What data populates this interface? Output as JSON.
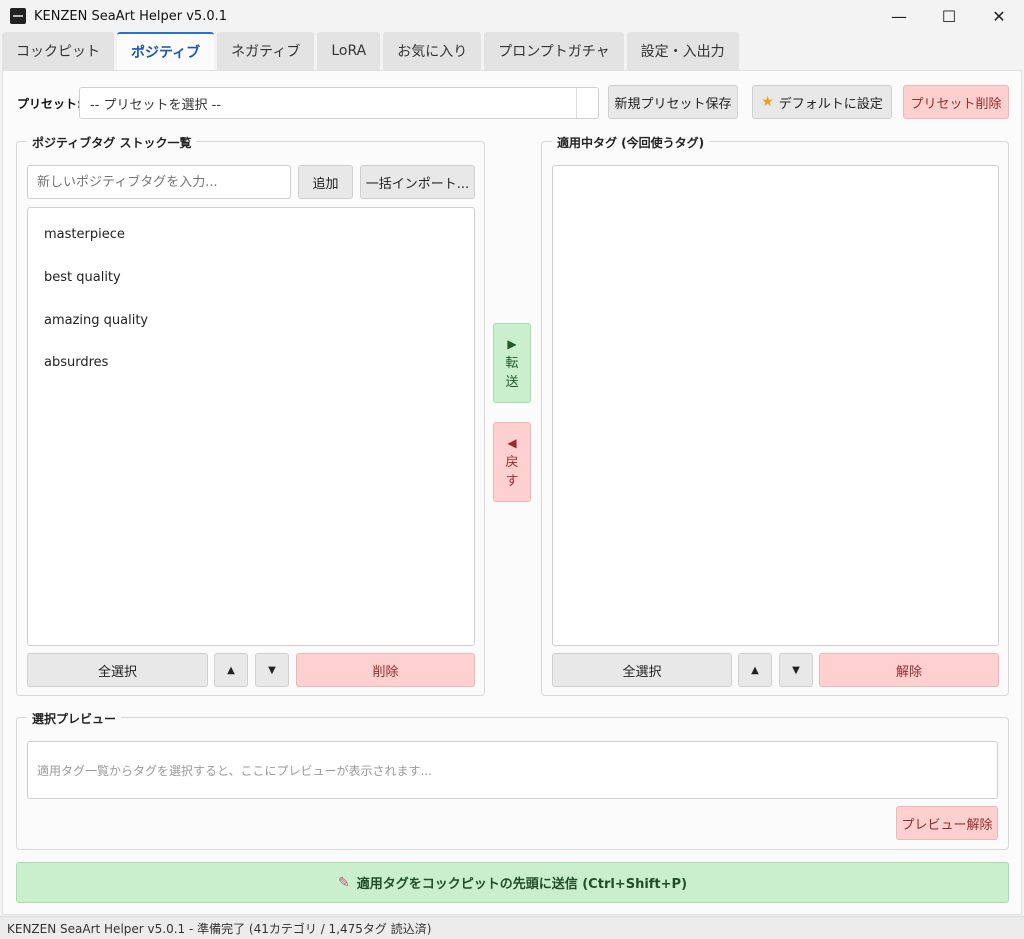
{
  "window": {
    "title": "KENZEN SeaArt Helper v5.0.1",
    "minimize": "—",
    "maximize": "☐",
    "close": "✕"
  },
  "tabs": [
    {
      "label": "コックピット",
      "active": false
    },
    {
      "label": "ポジティブ",
      "active": true
    },
    {
      "label": "ネガティブ",
      "active": false
    },
    {
      "label": "LoRA",
      "active": false
    },
    {
      "label": "お気に入り",
      "active": false
    },
    {
      "label": "プロンプトガチャ",
      "active": false
    },
    {
      "label": "設定・入出力",
      "active": false
    }
  ],
  "preset": {
    "label": "プリセット:",
    "selected": "-- プリセットを選択 --",
    "save_button": "新規プリセット保存",
    "default_button": "デフォルトに設定",
    "default_icon": "star-icon",
    "delete_button": "プリセット削除"
  },
  "stock": {
    "title": "ポジティブタグ ストック一覧",
    "input_placeholder": "新しいポジティブタグを入力...",
    "add_button": "追加",
    "import_button": "一括インポート...",
    "items": [
      "masterpiece",
      "best quality",
      "amazing quality",
      "absurdres"
    ],
    "select_all": "全選択",
    "move_up": "▲",
    "move_down": "▼",
    "delete": "削除"
  },
  "transfer": {
    "forward_arrow": "▶",
    "forward_line1": "転",
    "forward_line2": "送",
    "back_arrow": "◀",
    "back_line1": "戻",
    "back_line2": "す"
  },
  "applied": {
    "title": "適用中タグ (今回使うタグ)",
    "items": [],
    "select_all": "全選択",
    "move_up": "▲",
    "move_down": "▼",
    "release": "解除"
  },
  "preview": {
    "title": "選択プレビュー",
    "placeholder": "適用タグ一覧からタグを選択すると、ここにプレビューが表示されます...",
    "clear_button": "プレビュー解除"
  },
  "send": {
    "icon": "syringe-icon",
    "label": "適用タグをコックピットの先頭に送信 (Ctrl+Shift+P)"
  },
  "status": {
    "text": "KENZEN SeaArt Helper v5.0.1 - 準備完了 (41カテゴリ / 1,475タグ 読込済)"
  },
  "colors": {
    "accent": "#2c6fd1",
    "danger_bg": "#ffd0d0",
    "success_bg": "#c9efcc"
  }
}
